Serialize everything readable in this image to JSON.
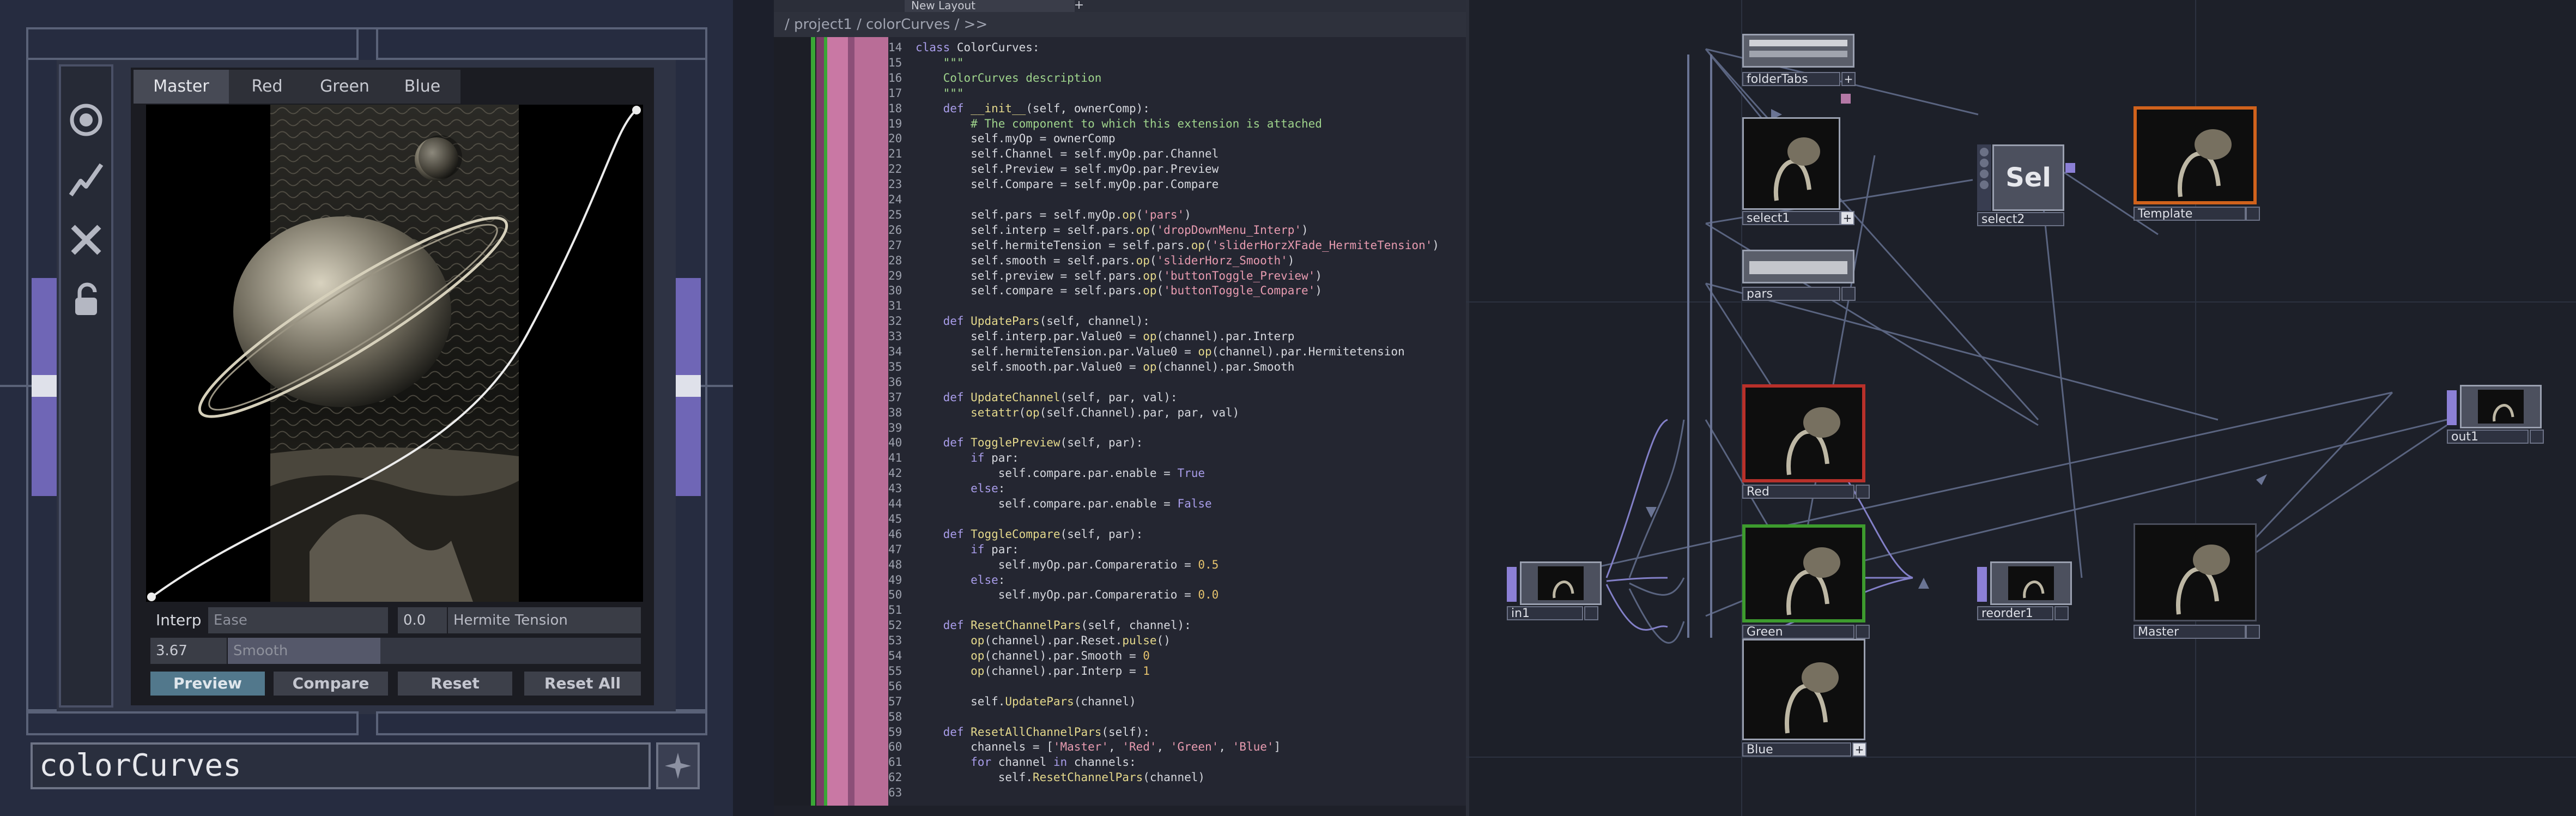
{
  "left_panel": {
    "tabs": [
      "Master",
      "Red",
      "Green",
      "Blue"
    ],
    "active_tab": "Master",
    "tools": [
      "target-icon",
      "graph-icon",
      "close-icon",
      "lock-icon"
    ],
    "interp_label": "Interp",
    "interp_value": "Ease",
    "tension_value": "0.0",
    "tension_label": "Hermite Tension",
    "smooth_value": "3.67",
    "smooth_label": "Smooth",
    "buttons": [
      "Preview",
      "Compare",
      "Reset",
      "Reset All"
    ],
    "active_button": "Preview",
    "component_name": "colorCurves"
  },
  "editor": {
    "tab_label": "New Layout",
    "breadcrumb": "/ project1 / colorCurves / >>",
    "lines": [
      {
        "n": "14",
        "t": "class ColorCurves:"
      },
      {
        "n": "15",
        "t": "    \"\"\""
      },
      {
        "n": "16",
        "t": "    ColorCurves description"
      },
      {
        "n": "17",
        "t": "    \"\"\""
      },
      {
        "n": "18",
        "t": "    def __init__(self, ownerComp):"
      },
      {
        "n": "19",
        "t": "        # The component to which this extension is attached"
      },
      {
        "n": "20",
        "t": "        self.myOp = ownerComp"
      },
      {
        "n": "21",
        "t": "        self.Channel = self.myOp.par.Channel"
      },
      {
        "n": "22",
        "t": "        self.Preview = self.myOp.par.Preview"
      },
      {
        "n": "23",
        "t": "        self.Compare = self.myOp.par.Compare"
      },
      {
        "n": "24",
        "t": ""
      },
      {
        "n": "25",
        "t": "        self.pars = self.myOp.op('pars')"
      },
      {
        "n": "26",
        "t": "        self.interp = self.pars.op('dropDownMenu_Interp')"
      },
      {
        "n": "27",
        "t": "        self.hermiteTension = self.pars.op('sliderHorzXFade_HermiteTension')"
      },
      {
        "n": "28",
        "t": "        self.smooth = self.pars.op('sliderHorz_Smooth')"
      },
      {
        "n": "29",
        "t": "        self.preview = self.pars.op('buttonToggle_Preview')"
      },
      {
        "n": "30",
        "t": "        self.compare = self.pars.op('buttonToggle_Compare')"
      },
      {
        "n": "31",
        "t": ""
      },
      {
        "n": "32",
        "t": "    def UpdatePars(self, channel):"
      },
      {
        "n": "33",
        "t": "        self.interp.par.Value0 = op(channel).par.Interp"
      },
      {
        "n": "34",
        "t": "        self.hermiteTension.par.Value0 = op(channel).par.Hermitetension"
      },
      {
        "n": "35",
        "t": "        self.smooth.par.Value0 = op(channel).par.Smooth"
      },
      {
        "n": "36",
        "t": ""
      },
      {
        "n": "37",
        "t": "    def UpdateChannel(self, par, val):"
      },
      {
        "n": "38",
        "t": "        setattr(op(self.Channel).par, par, val)"
      },
      {
        "n": "39",
        "t": ""
      },
      {
        "n": "40",
        "t": "    def TogglePreview(self, par):"
      },
      {
        "n": "41",
        "t": "        if par:"
      },
      {
        "n": "42",
        "t": "            self.compare.par.enable = True"
      },
      {
        "n": "43",
        "t": "        else:"
      },
      {
        "n": "44",
        "t": "            self.compare.par.enable = False"
      },
      {
        "n": "45",
        "t": ""
      },
      {
        "n": "46",
        "t": "    def ToggleCompare(self, par):"
      },
      {
        "n": "47",
        "t": "        if par:"
      },
      {
        "n": "48",
        "t": "            self.myOp.par.Compareratio = 0.5"
      },
      {
        "n": "49",
        "t": "        else:"
      },
      {
        "n": "50",
        "t": "            self.myOp.par.Compareratio = 0.0"
      },
      {
        "n": "51",
        "t": ""
      },
      {
        "n": "52",
        "t": "    def ResetChannelPars(self, channel):"
      },
      {
        "n": "53",
        "t": "        op(channel).par.Reset.pulse()"
      },
      {
        "n": "54",
        "t": "        op(channel).par.Smooth = 0"
      },
      {
        "n": "55",
        "t": "        op(channel).par.Interp = 1"
      },
      {
        "n": "56",
        "t": ""
      },
      {
        "n": "57",
        "t": "        self.UpdatePars(channel)"
      },
      {
        "n": "58",
        "t": ""
      },
      {
        "n": "59",
        "t": "    def ResetAllChannelPars(self):"
      },
      {
        "n": "60",
        "t": "        channels = ['Master', 'Red', 'Green', 'Blue']"
      },
      {
        "n": "61",
        "t": "        for channel in channels:"
      },
      {
        "n": "62",
        "t": "            self.ResetChannelPars(channel)"
      },
      {
        "n": "63",
        "t": ""
      }
    ]
  },
  "network": {
    "nodes": {
      "folderTabs": "folderTabs",
      "select1": "select1",
      "select2": "select2",
      "select2_text": "Sel",
      "template": "Template",
      "pars": "pars",
      "red": "Red",
      "green": "Green",
      "blue": "Blue",
      "master": "Master",
      "in1": "in1",
      "reorder1": "reorder1",
      "out1": "out1"
    }
  },
  "colors": {
    "accent": "#8c80d6",
    "red_border": "#b8302a",
    "green_border": "#3d9b2e",
    "template_border": "#d0621c",
    "preview_active": "#52788c"
  }
}
